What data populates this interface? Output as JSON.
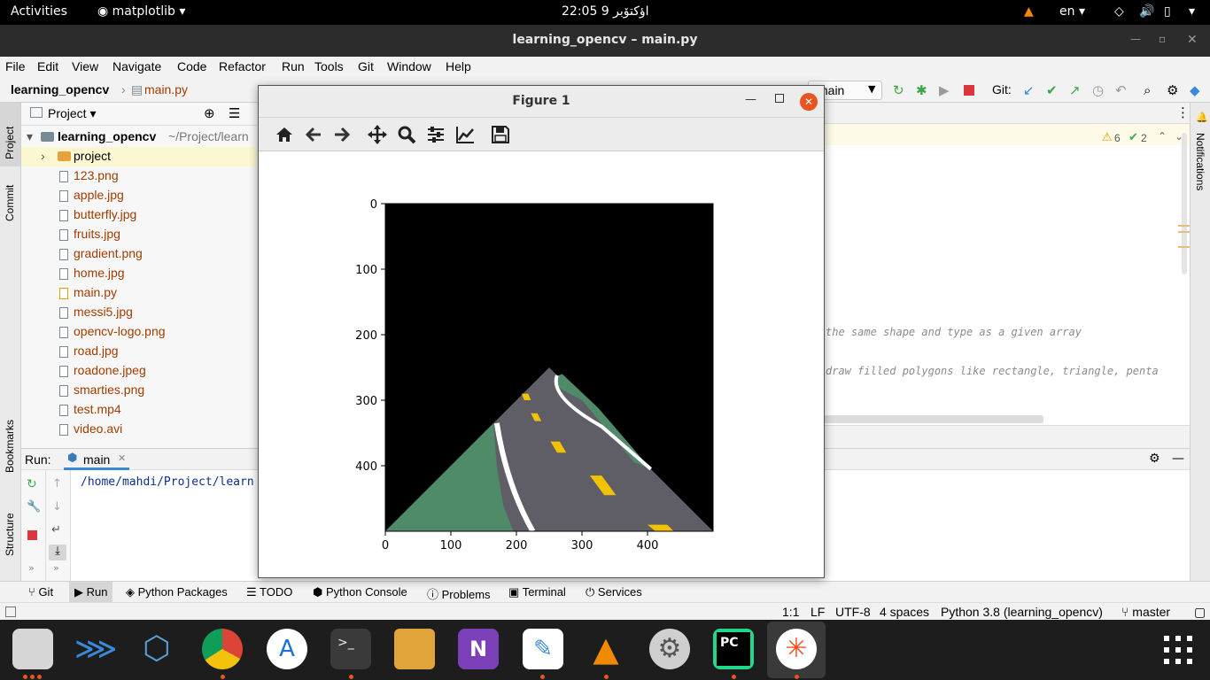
{
  "topbar": {
    "activities": "Activities",
    "app_menu": "matplotlib",
    "clock": "22:05  9 اؤکتۆبر",
    "lang": "en"
  },
  "window": {
    "title": "learning_opencv – main.py"
  },
  "menu": [
    "File",
    "Edit",
    "View",
    "Navigate",
    "Code",
    "Refactor",
    "Run",
    "Tools",
    "Git",
    "Window",
    "Help"
  ],
  "nav": {
    "project": "learning_opencv",
    "file": "main.py",
    "branch": "main",
    "git_label": "Git:"
  },
  "project_panel": {
    "header": "Project",
    "root": "learning_opencv",
    "root_path": "~/Project/learn",
    "folder": "project",
    "files": [
      "123.png",
      "apple.jpg",
      "butterfly.jpg",
      "fruits.jpg",
      "gradient.png",
      "home.jpg",
      "main.py",
      "messi5.jpg",
      "opencv-logo.png",
      "road.jpg",
      "roadone.jpeg",
      "smarties.png",
      "test.mp4",
      "video.avi"
    ]
  },
  "side_tabs": {
    "project": "Project",
    "commit": "Commit",
    "bookmarks": "Bookmarks",
    "structure": "Structure",
    "notifications": "Notifications"
  },
  "editor": {
    "warnings": "6",
    "checks": "2",
    "comment1": "the same shape and type as a given array",
    "comment2": "draw filled polygons like rectangle, triangle, penta"
  },
  "run": {
    "label": "Run:",
    "tab": "main",
    "output": "/home/mahdi/Project/learn"
  },
  "bottom_tools": [
    "Git",
    "Run",
    "Python Packages",
    "TODO",
    "Python Console",
    "Problems",
    "Terminal",
    "Services"
  ],
  "status": {
    "pos": "1:1",
    "eol": "LF",
    "enc": "UTF-8",
    "indent": "4 spaces",
    "interpreter": "Python 3.8 (learning_opencv)",
    "branch": "master"
  },
  "figure": {
    "title": "Figure 1"
  },
  "chart_data": {
    "type": "image",
    "x_ticks": [
      "0",
      "100",
      "200",
      "300",
      "400"
    ],
    "y_ticks": [
      "0",
      "100",
      "200",
      "300",
      "400"
    ],
    "xlim": [
      0,
      500
    ],
    "ylim": [
      500,
      0
    ],
    "title": "",
    "xlabel": "",
    "ylabel": ""
  },
  "colors": {
    "accent": "#e95420",
    "road": "#5f5d66",
    "grass": "#4f8a69",
    "stripe": "#f2c200"
  }
}
